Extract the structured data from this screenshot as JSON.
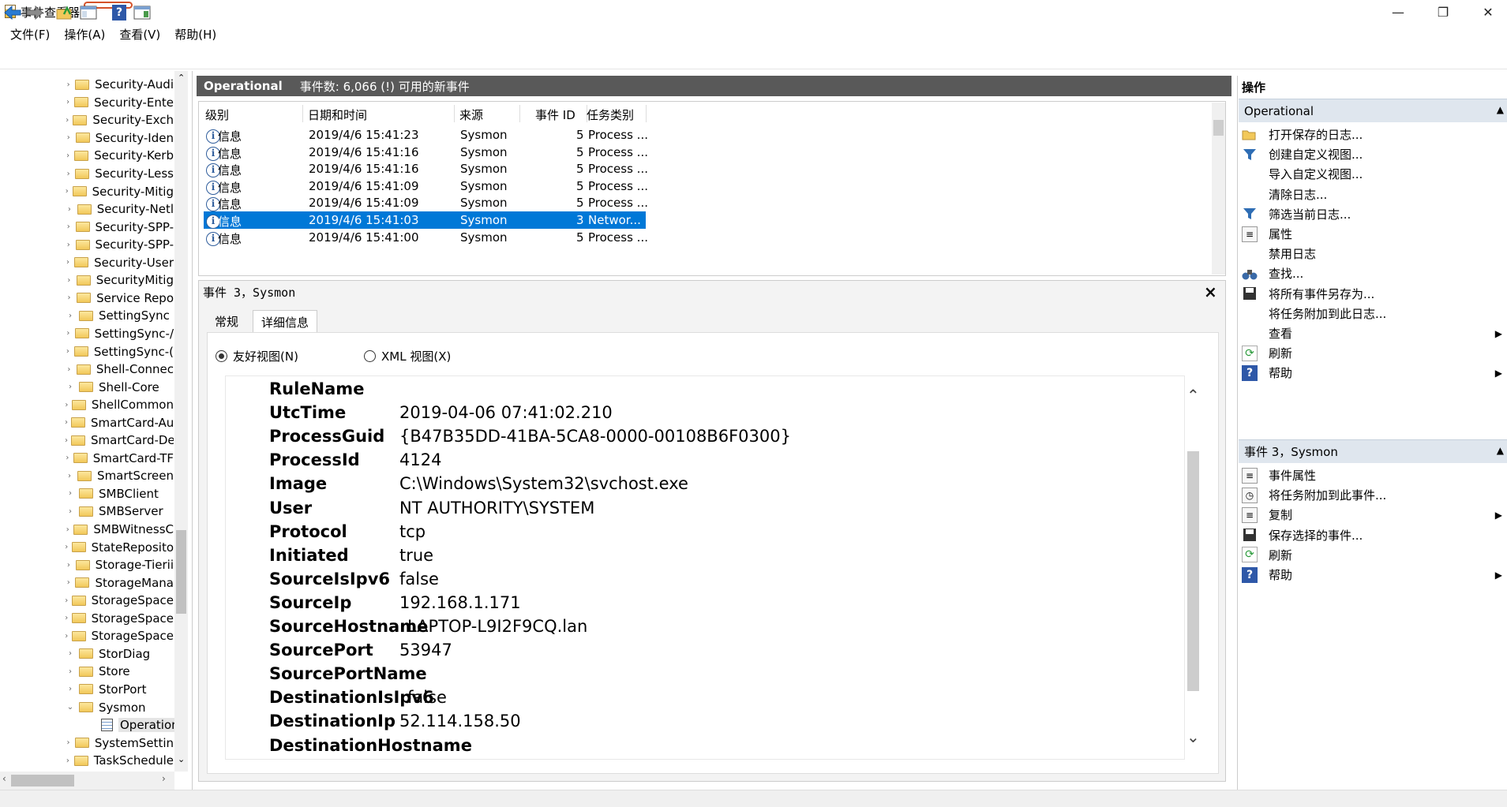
{
  "window": {
    "title": "事件查看器",
    "minimize_glyph": "—",
    "maximize_glyph": "❐",
    "close_glyph": "✕"
  },
  "menu": [
    "文件(F)",
    "操作(A)",
    "查看(V)",
    "帮助(H)"
  ],
  "tree": {
    "items": [
      {
        "label": "Security-Audi",
        "expanded": false
      },
      {
        "label": "Security-Ente",
        "expanded": false
      },
      {
        "label": "Security-Exch",
        "expanded": false
      },
      {
        "label": "Security-Iden",
        "expanded": false
      },
      {
        "label": "Security-Kerb",
        "expanded": false
      },
      {
        "label": "Security-Less",
        "expanded": false
      },
      {
        "label": "Security-Mitig",
        "expanded": false
      },
      {
        "label": "Security-Netl",
        "expanded": false
      },
      {
        "label": "Security-SPP-",
        "expanded": false
      },
      {
        "label": "Security-SPP-",
        "expanded": false
      },
      {
        "label": "Security-User",
        "expanded": false
      },
      {
        "label": "SecurityMitig",
        "expanded": false
      },
      {
        "label": "Service Repo",
        "expanded": false
      },
      {
        "label": "SettingSync",
        "expanded": false
      },
      {
        "label": "SettingSync-/",
        "expanded": false
      },
      {
        "label": "SettingSync-(",
        "expanded": false
      },
      {
        "label": "Shell-Connec",
        "expanded": false
      },
      {
        "label": "Shell-Core",
        "expanded": false
      },
      {
        "label": "ShellCommon",
        "expanded": false
      },
      {
        "label": "SmartCard-Au",
        "expanded": false
      },
      {
        "label": "SmartCard-De",
        "expanded": false
      },
      {
        "label": "SmartCard-TF",
        "expanded": false
      },
      {
        "label": "SmartScreen",
        "expanded": false
      },
      {
        "label": "SMBClient",
        "expanded": false
      },
      {
        "label": "SMBServer",
        "expanded": false
      },
      {
        "label": "SMBWitnessC",
        "expanded": false
      },
      {
        "label": "StateReposito",
        "expanded": false
      },
      {
        "label": "Storage-Tierii",
        "expanded": false
      },
      {
        "label": "StorageMana",
        "expanded": false
      },
      {
        "label": "StorageSpace",
        "expanded": false
      },
      {
        "label": "StorageSpace",
        "expanded": false
      },
      {
        "label": "StorageSpace",
        "expanded": false
      },
      {
        "label": "StorDiag",
        "expanded": false
      },
      {
        "label": "Store",
        "expanded": false
      },
      {
        "label": "StorPort",
        "expanded": false
      },
      {
        "label": "Sysmon",
        "expanded": true
      },
      {
        "label": "Operation",
        "child": true
      },
      {
        "label": "SystemSettin",
        "expanded": false
      },
      {
        "label": "TaskSchedule",
        "expanded": false
      }
    ]
  },
  "center": {
    "log_name": "Operational",
    "event_count": "事件数: 6,066 (!) 可用的新事件",
    "columns": [
      "级别",
      "日期和时间",
      "来源",
      "事件 ID",
      "任务类别"
    ],
    "rows": [
      {
        "level": "信息",
        "datetime": "2019/4/6 15:41:23",
        "source": "Sysmon",
        "id": "5",
        "task": "Process ..."
      },
      {
        "level": "信息",
        "datetime": "2019/4/6 15:41:16",
        "source": "Sysmon",
        "id": "5",
        "task": "Process ..."
      },
      {
        "level": "信息",
        "datetime": "2019/4/6 15:41:16",
        "source": "Sysmon",
        "id": "5",
        "task": "Process ..."
      },
      {
        "level": "信息",
        "datetime": "2019/4/6 15:41:09",
        "source": "Sysmon",
        "id": "5",
        "task": "Process ..."
      },
      {
        "level": "信息",
        "datetime": "2019/4/6 15:41:09",
        "source": "Sysmon",
        "id": "5",
        "task": "Process ..."
      },
      {
        "level": "信息",
        "datetime": "2019/4/6 15:41:03",
        "source": "Sysmon",
        "id": "3",
        "task": "Networ...",
        "selected": true
      },
      {
        "level": "信息",
        "datetime": "2019/4/6 15:41:00",
        "source": "Sysmon",
        "id": "5",
        "task": "Process ..."
      }
    ],
    "detail": {
      "title": "事件 3，Sysmon",
      "tab_general": "常规",
      "tab_details": "详细信息",
      "radio_friendly": "友好视图(N)",
      "radio_xml": "XML 视图(X)",
      "fields": [
        {
          "k": "RuleName",
          "v": ""
        },
        {
          "k": "UtcTime",
          "v": "2019-04-06 07:41:02.210"
        },
        {
          "k": "ProcessGuid",
          "v": "{B47B35DD-41BA-5CA8-0000-00108B6F0300}"
        },
        {
          "k": "ProcessId",
          "v": "4124"
        },
        {
          "k": "Image",
          "v": "C:\\Windows\\System32\\svchost.exe"
        },
        {
          "k": "User",
          "v": "NT AUTHORITY\\SYSTEM"
        },
        {
          "k": "Protocol",
          "v": "tcp"
        },
        {
          "k": "Initiated",
          "v": "true"
        },
        {
          "k": "SourceIsIpv6",
          "v": "false"
        },
        {
          "k": "SourceIp",
          "v": "192.168.1.171"
        },
        {
          "k": "SourceHostname",
          "v": "LAPTOP-L9I2F9CQ.lan"
        },
        {
          "k": "SourcePort",
          "v": "53947"
        },
        {
          "k": "SourcePortName",
          "v": ""
        },
        {
          "k": "DestinationIsIpv6",
          "v": "false"
        },
        {
          "k": "DestinationIp",
          "v": "52.114.158.50"
        },
        {
          "k": "DestinationHostname",
          "v": ""
        }
      ]
    }
  },
  "actions": {
    "title": "操作",
    "section1": "Operational",
    "section1_items": [
      {
        "label": "打开保存的日志...",
        "icon": "folder-open-icon"
      },
      {
        "label": "创建自定义视图...",
        "icon": "filter-icon"
      },
      {
        "label": "导入自定义视图...",
        "icon": ""
      },
      {
        "label": "清除日志...",
        "icon": ""
      },
      {
        "label": "筛选当前日志...",
        "icon": "filter-icon"
      },
      {
        "label": "属性",
        "icon": "properties-icon"
      },
      {
        "label": "禁用日志",
        "icon": ""
      },
      {
        "label": "查找...",
        "icon": "binoculars-icon"
      },
      {
        "label": "将所有事件另存为...",
        "icon": "save-icon"
      },
      {
        "label": "将任务附加到此日志...",
        "icon": ""
      },
      {
        "label": "查看",
        "icon": "",
        "submenu": true
      },
      {
        "label": "刷新",
        "icon": "refresh-icon"
      },
      {
        "label": "帮助",
        "icon": "help-icon",
        "submenu": true
      }
    ],
    "section2": "事件 3，Sysmon",
    "section2_items": [
      {
        "label": "事件属性",
        "icon": "properties-icon"
      },
      {
        "label": "将任务附加到此事件...",
        "icon": "task-icon"
      },
      {
        "label": "复制",
        "icon": "copy-icon",
        "submenu": true
      },
      {
        "label": "保存选择的事件...",
        "icon": "save-icon"
      },
      {
        "label": "刷新",
        "icon": "refresh-icon"
      },
      {
        "label": "帮助",
        "icon": "help-icon",
        "submenu": true
      }
    ]
  }
}
